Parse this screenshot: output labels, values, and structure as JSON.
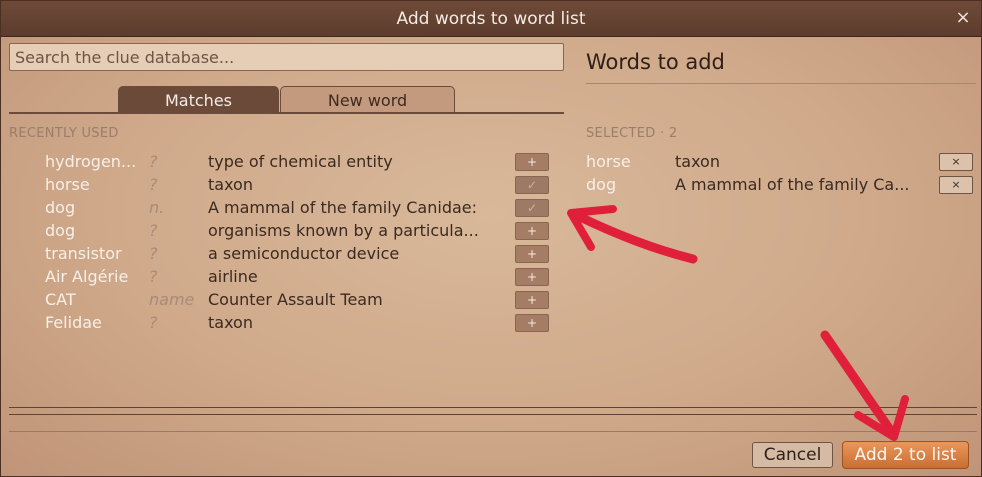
{
  "window": {
    "title": "Add words to word list",
    "close_glyph": "×"
  },
  "search": {
    "placeholder": "Search the clue database..."
  },
  "tabs": [
    {
      "label": "Matches",
      "active": true
    },
    {
      "label": "New word",
      "active": false
    }
  ],
  "recent": {
    "label": "RECENTLY USED",
    "rows": [
      {
        "word": "hydrogen...",
        "pos": "?",
        "clue": "type of chemical entity",
        "added": false
      },
      {
        "word": "horse",
        "pos": "?",
        "clue": "taxon",
        "added": true
      },
      {
        "word": "dog",
        "pos": "n.",
        "clue": "A mammal of the family Canidae:",
        "added": true
      },
      {
        "word": "dog",
        "pos": "?",
        "clue": "organisms known by a particula...",
        "added": false
      },
      {
        "word": "transistor",
        "pos": "?",
        "clue": "a semiconductor device",
        "added": false
      },
      {
        "word": "Air Algérie",
        "pos": "?",
        "clue": "airline",
        "added": false
      },
      {
        "word": "CAT",
        "pos": "name",
        "clue": "Counter Assault Team",
        "added": false
      },
      {
        "word": "Felidae",
        "pos": "?",
        "clue": "taxon",
        "added": false
      }
    ],
    "add_glyph": "+",
    "added_glyph": "✓"
  },
  "selected": {
    "heading": "Words to add",
    "label": "SELECTED · 2",
    "remove_glyph": "×",
    "rows": [
      {
        "word": "horse",
        "clue": "taxon"
      },
      {
        "word": "dog",
        "clue": "A mammal of the family Ca..."
      }
    ]
  },
  "footer": {
    "cancel_label": "Cancel",
    "add_label": "Add 2 to list"
  },
  "colors": {
    "accent": "#d9813f",
    "annotation": "#e0203a",
    "tab_active": "#6b4a3a"
  }
}
